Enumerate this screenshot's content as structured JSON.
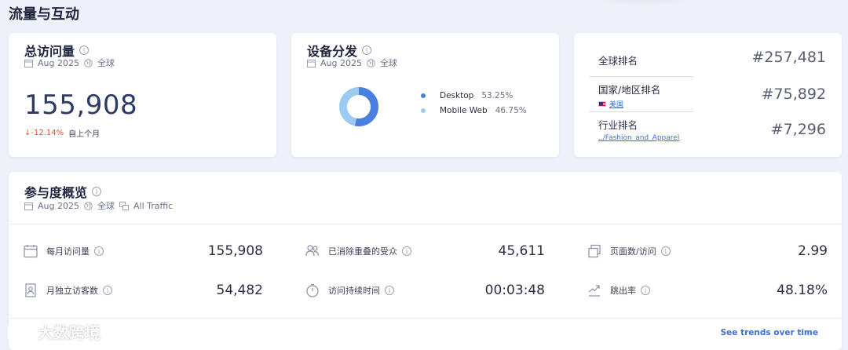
{
  "section": {
    "title": "流量与互动"
  },
  "visits_card": {
    "title": "总访问量",
    "date": "Aug 2025",
    "region": "全球",
    "value": "155,908",
    "change": "-12.14%",
    "change_label": "自上个月"
  },
  "device_card": {
    "title": "设备分发",
    "date": "Aug 2025",
    "region": "全球",
    "items": [
      {
        "name": "Desktop",
        "pct": "53.25%",
        "share": 0.5325,
        "color": "#4a7fe0"
      },
      {
        "name": "Mobile Web",
        "pct": "46.75%",
        "share": 0.4675,
        "color": "#9ccbf2"
      }
    ]
  },
  "rank_card": {
    "global": {
      "label": "全球排名",
      "value": "#257,481"
    },
    "country": {
      "label": "国家/地区排名",
      "sub": "美国",
      "value": "#75,892"
    },
    "industry": {
      "label": "行业排名",
      "sub": "../Fashion_and_Apparel",
      "value": "#7,296"
    }
  },
  "engagement": {
    "title": "参与度概览",
    "date": "Aug 2025",
    "region": "全球",
    "traffic": "All Traffic",
    "metrics": [
      {
        "label": "每月访问量",
        "value": "155,908",
        "icon": "calendar-icon"
      },
      {
        "label": "已消除重叠的受众",
        "value": "45,611",
        "icon": "users-icon"
      },
      {
        "label": "页面数/访问",
        "value": "2.99",
        "icon": "pages-icon"
      },
      {
        "label": "月独立访客数",
        "value": "54,482",
        "icon": "visitor-icon"
      },
      {
        "label": "访问持续时间",
        "value": "00:03:48",
        "icon": "timer-icon"
      },
      {
        "label": "跳出率",
        "value": "48.18%",
        "icon": "bounce-icon"
      }
    ],
    "trends_link": "See trends over time"
  },
  "watermark": {
    "text": "大数跨境"
  }
}
